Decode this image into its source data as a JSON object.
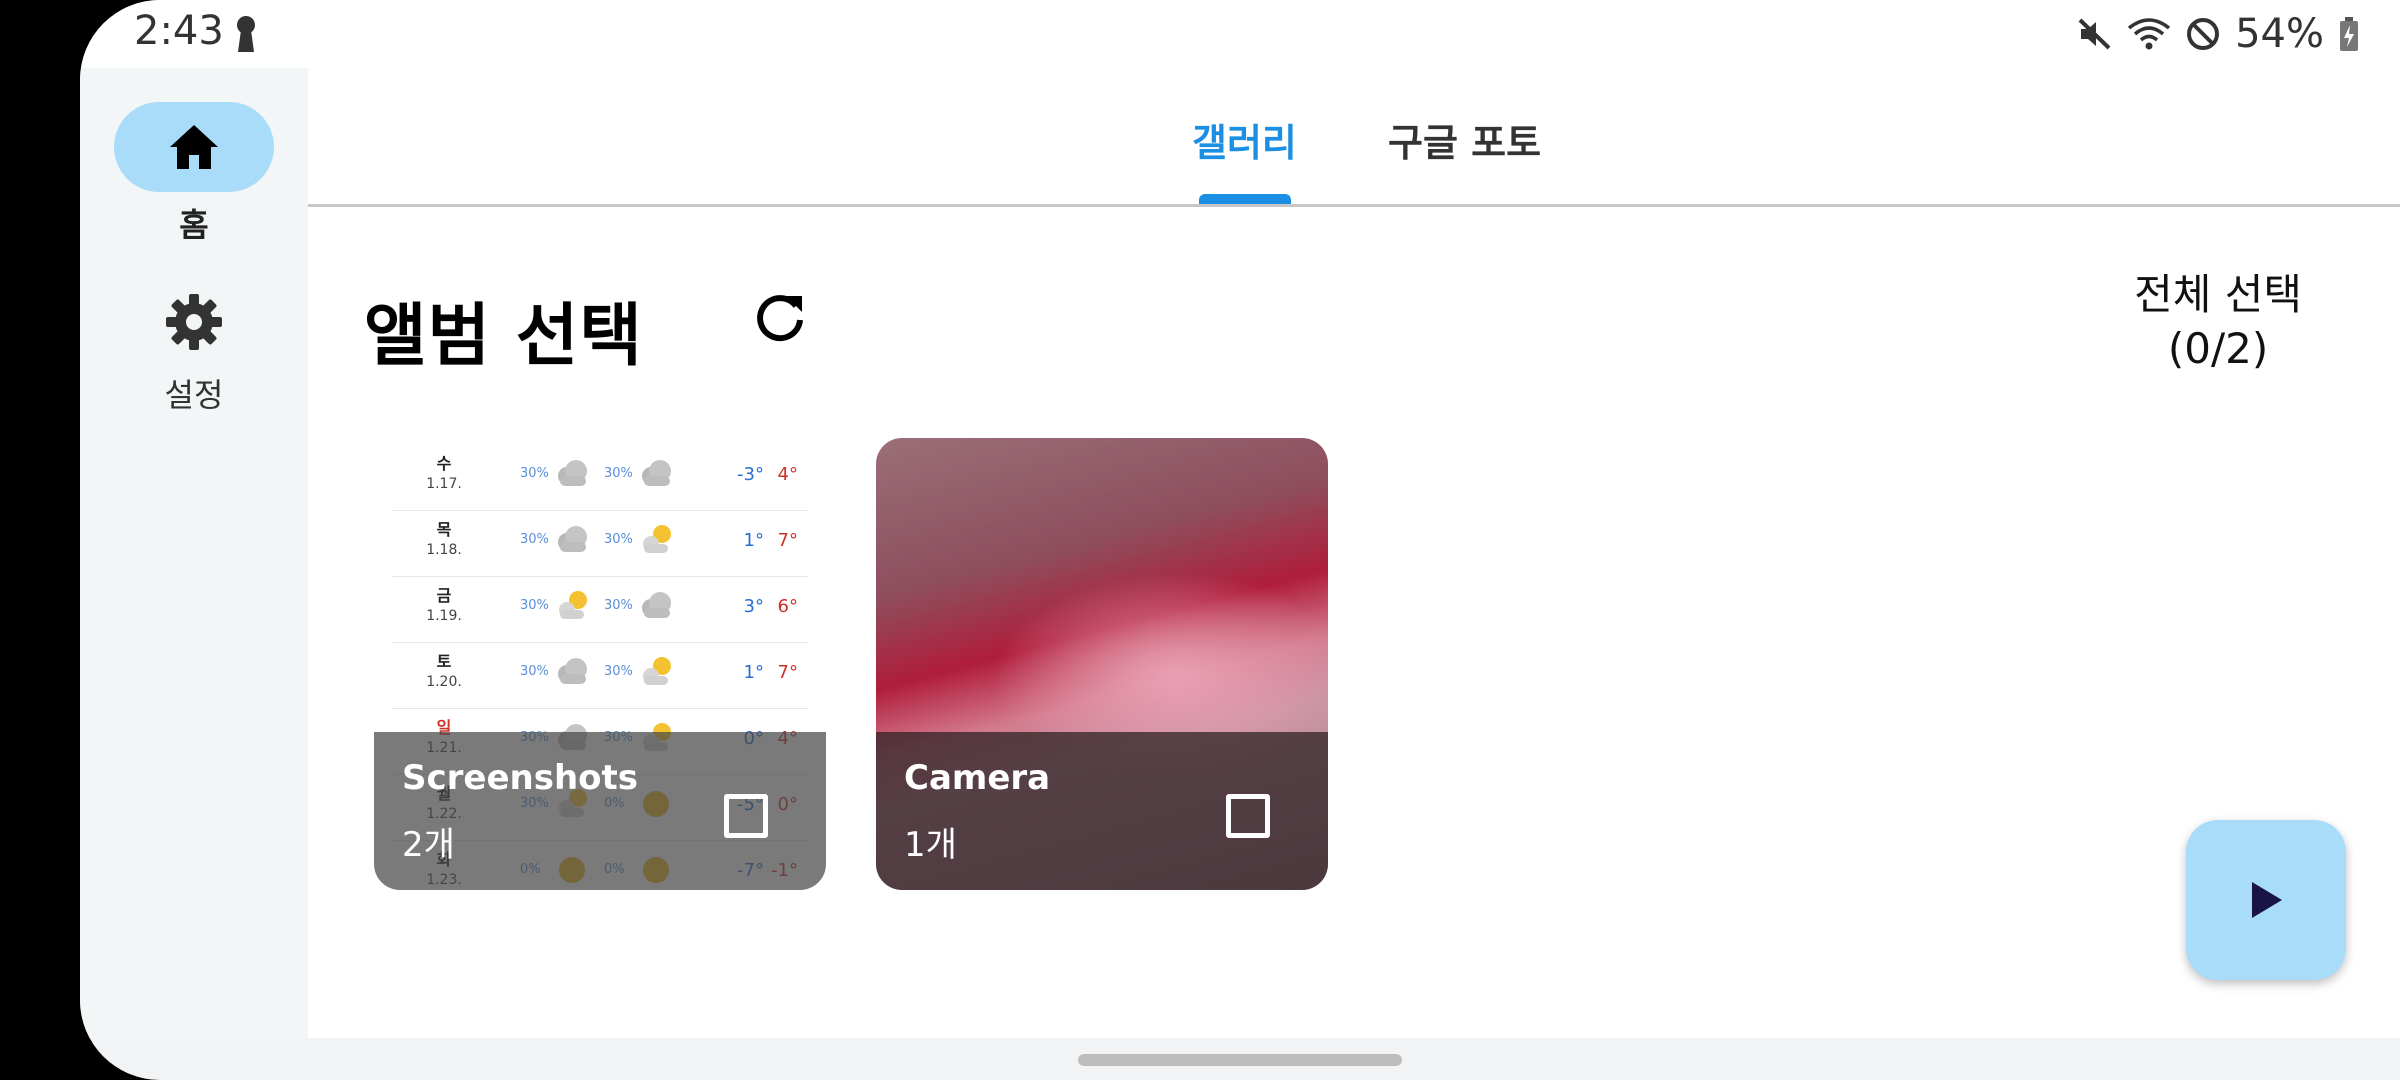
{
  "status_bar": {
    "time": "2:43",
    "battery": "54%"
  },
  "sidebar": {
    "items": [
      {
        "label": "홈",
        "icon": "home-icon",
        "active": true
      },
      {
        "label": "설정",
        "icon": "gear-icon",
        "active": false
      }
    ]
  },
  "tabs": [
    {
      "label": "갤러리",
      "active": true
    },
    {
      "label": "구글 포토",
      "active": false
    }
  ],
  "main": {
    "title": "앨범 선택",
    "select_all_line1": "전체 선택",
    "select_all_line2": "(0/2)"
  },
  "albums": [
    {
      "name": "Screenshots",
      "count": "2개",
      "checked": false
    },
    {
      "name": "Camera",
      "count": "1개",
      "checked": false
    }
  ],
  "weather_thumbnail": [
    {
      "day": "수",
      "date": "1.17.",
      "p1": "30%",
      "p2": "30%",
      "lo": "-3°",
      "hi": "4°"
    },
    {
      "day": "목",
      "date": "1.18.",
      "p1": "30%",
      "p2": "30%",
      "lo": "1°",
      "hi": "7°"
    },
    {
      "day": "금",
      "date": "1.19.",
      "p1": "30%",
      "p2": "30%",
      "lo": "3°",
      "hi": "6°"
    },
    {
      "day": "토",
      "date": "1.20.",
      "p1": "30%",
      "p2": "30%",
      "lo": "1°",
      "hi": "7°"
    },
    {
      "day": "일",
      "date": "1.21.",
      "p1": "30%",
      "p2": "30%",
      "lo": "0°",
      "hi": "4°"
    },
    {
      "day": "월",
      "date": "1.22.",
      "p1": "30%",
      "p2": "0%",
      "lo": "-5°",
      "hi": "0°"
    },
    {
      "day": "화",
      "date": "1.23.",
      "p1": "0%",
      "p2": "0%",
      "lo": "-7°",
      "hi": "-1°"
    }
  ],
  "colors": {
    "accent": "#1a8fe3",
    "pill": "#a8dcf8"
  }
}
